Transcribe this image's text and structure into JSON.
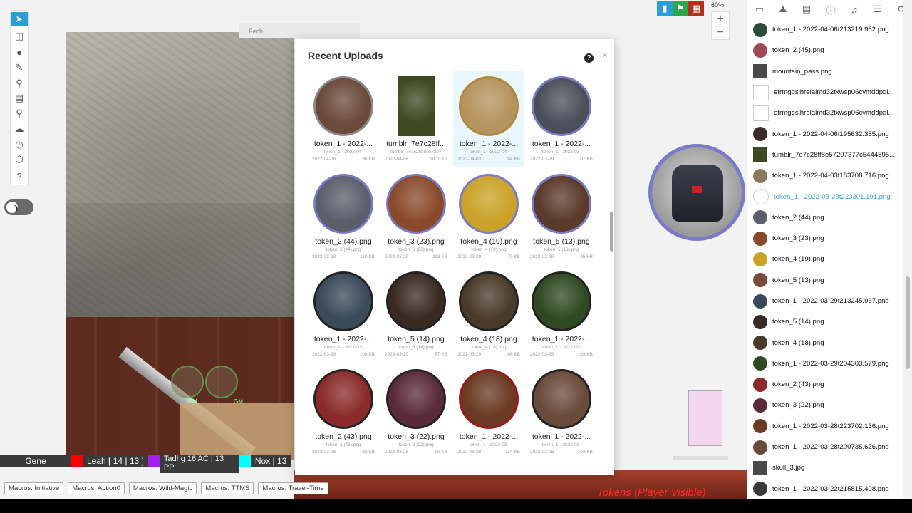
{
  "dialog": {
    "title": "Recent Uploads",
    "help_label": "?",
    "close_label": "×",
    "tiles": [
      {
        "name": "token_1 - 2022-...",
        "sub": "token_1 - 2022-04-",
        "date": "2022-04-06",
        "size": "90 KB",
        "ring": "#888",
        "fill": "#6b4a3a"
      },
      {
        "name": "tumblr_7e7c28ff...",
        "sub": "tumblr_7e7c28ff8e57207",
        "date": "2022-04-06",
        "size": "1001 KB",
        "ring": "none",
        "fill": "#3f4a22"
      },
      {
        "name": "token_1 - 2022-...",
        "sub": "token_1 - 2022-04-",
        "date": "2022-04-03",
        "size": "84 KB",
        "ring": "#b08a3a",
        "fill": "#b5945f"
      },
      {
        "name": "token_1 - 2022-...",
        "sub": "token_1 - 2022-03-",
        "date": "2022-03-29",
        "size": "107 KB",
        "ring": "#7a7bc8",
        "fill": "#4a4f5a"
      },
      {
        "name": "token_2 (44).png",
        "sub": "token_2 (44).png",
        "date": "2022-03-29",
        "size": "110 KB",
        "ring": "#7a7bc8",
        "fill": "#5a5f6a"
      },
      {
        "name": "token_3 (23).png",
        "sub": "token_3 (23).png",
        "date": "2022-03-29",
        "size": "113 KB",
        "ring": "#7a7bc8",
        "fill": "#8a4a2a"
      },
      {
        "name": "token_4 (19).png",
        "sub": "token_4 (19).png",
        "date": "2022-03-29",
        "size": "70 KB",
        "ring": "#7a7bc8",
        "fill": "#c9a227"
      },
      {
        "name": "token_5 (13).png",
        "sub": "token_5 (13).png",
        "date": "2022-03-29",
        "size": "85 KB",
        "ring": "#7a7bc8",
        "fill": "#5a3a2a"
      },
      {
        "name": "token_1 - 2022-...",
        "sub": "token_1 - 2022-03-",
        "date": "2022-03-29",
        "size": "100 KB",
        "ring": "#222",
        "fill": "#3a4a5a"
      },
      {
        "name": "token_5 (14).png",
        "sub": "token_5 (14).png",
        "date": "2022-03-29",
        "size": "87 KB",
        "ring": "#222",
        "fill": "#3a2a22"
      },
      {
        "name": "token_4 (18).png",
        "sub": "token_4 (18).png",
        "date": "2022-03-29",
        "size": "86 KB",
        "ring": "#222",
        "fill": "#4a3a2a"
      },
      {
        "name": "token_1 - 2022-...",
        "sub": "token_1 - 2022-03-",
        "date": "2022-03-29",
        "size": "109 KB",
        "ring": "#222",
        "fill": "#2f4a22"
      },
      {
        "name": "token_2 (43).png",
        "sub": "token_2 (43).png",
        "date": "2022-03-28",
        "size": "82 KB",
        "ring": "#222",
        "fill": "#8a2a2a"
      },
      {
        "name": "token_3 (22).png",
        "sub": "token_3 (22).png",
        "date": "2022-03-28",
        "size": "90 KB",
        "ring": "#222",
        "fill": "#5a2a3a"
      },
      {
        "name": "token_1 - 2022-...",
        "sub": "token_1 - 2022-03-",
        "date": "2022-03-28",
        "size": "114 KB",
        "ring": "#9a1a1a",
        "fill": "#6a3a22"
      },
      {
        "name": "token_1 - 2022-...",
        "sub": "token_1 - 2022-03-",
        "date": "2022-03-28",
        "size": "102 KB",
        "ring": "#222",
        "fill": "#6a4a3a"
      }
    ]
  },
  "assets": [
    {
      "name": "token_1 - 2022-04-06t213219.962.png",
      "color": "#2a4a3a"
    },
    {
      "name": "token_2 (45).png",
      "color": "#9a4a5a"
    },
    {
      "name": "mountain_pass.png",
      "color": "#4a4a4a",
      "square": true
    },
    {
      "name": "efrmgosihrelalmd32txwsp06cvmddpql...",
      "color": "#fff",
      "square": true
    },
    {
      "name": "efrmgosihrelalmd32txwsp06cvmddpql...",
      "color": "#fff",
      "square": true
    },
    {
      "name": "token_1 - 2022-04-06t195632.355.png",
      "color": "#3a2a2a"
    },
    {
      "name": "tumblr_7e7c28ff8e57207377c5444595...",
      "color": "#3f4a22",
      "square": true
    },
    {
      "name": "token_1 - 2022-04-03t183708.716.png",
      "color": "#8a7a5a"
    },
    {
      "name": "token_1 - 2022-03-29t223301.191.png",
      "color": "#fff",
      "hover": true
    },
    {
      "name": "token_2 (44).png",
      "color": "#5a5f6a"
    },
    {
      "name": "token_3 (23).png",
      "color": "#8a4a2a"
    },
    {
      "name": "token_4 (19).png",
      "color": "#c9a227"
    },
    {
      "name": "token_5 (13).png",
      "color": "#7a4a3a"
    },
    {
      "name": "token_1 - 2022-03-29t213245.937.png",
      "color": "#3a4a5a"
    },
    {
      "name": "token_5 (14).png",
      "color": "#3a2a22"
    },
    {
      "name": "token_4 (18).png",
      "color": "#4a3a2a"
    },
    {
      "name": "token_1 - 2022-03-29t204303.579.png",
      "color": "#2f4a22"
    },
    {
      "name": "token_2 (43).png",
      "color": "#8a2a2a"
    },
    {
      "name": "token_3 (22).png",
      "color": "#5a2a3a"
    },
    {
      "name": "token_1 - 2022-03-28t223702.136.png",
      "color": "#6a3a22"
    },
    {
      "name": "token_1 - 2022-03-28t200735.626.png",
      "color": "#6a4a3a"
    },
    {
      "name": "skull_3.jpg",
      "color": "#4a4a4a",
      "square": true
    },
    {
      "name": "token_1 - 2022-03-22t215815.408.png",
      "color": "#3a3a3a"
    }
  ],
  "players": [
    {
      "name": "Gene",
      "color": "#ff0000"
    },
    {
      "name": "Leah [ 14 | 13 ]",
      "color": "#a020f0"
    },
    {
      "name": "Tadhg 16 AC | 13 PP",
      "color": "#00ffff"
    },
    {
      "name": "Nox | 13",
      "color": ""
    }
  ],
  "macros": [
    "Macros: Initiative",
    "Macros: Action0",
    "Macros: Wild-Magic",
    "Macros: TTMS",
    "Macros: Travel-Time"
  ],
  "canvas": {
    "search_placeholder": "Fech",
    "zoom": "60%",
    "zoom_in": "+",
    "zoom_out": "−",
    "layer_label": "Tokens (Player Visible)"
  }
}
